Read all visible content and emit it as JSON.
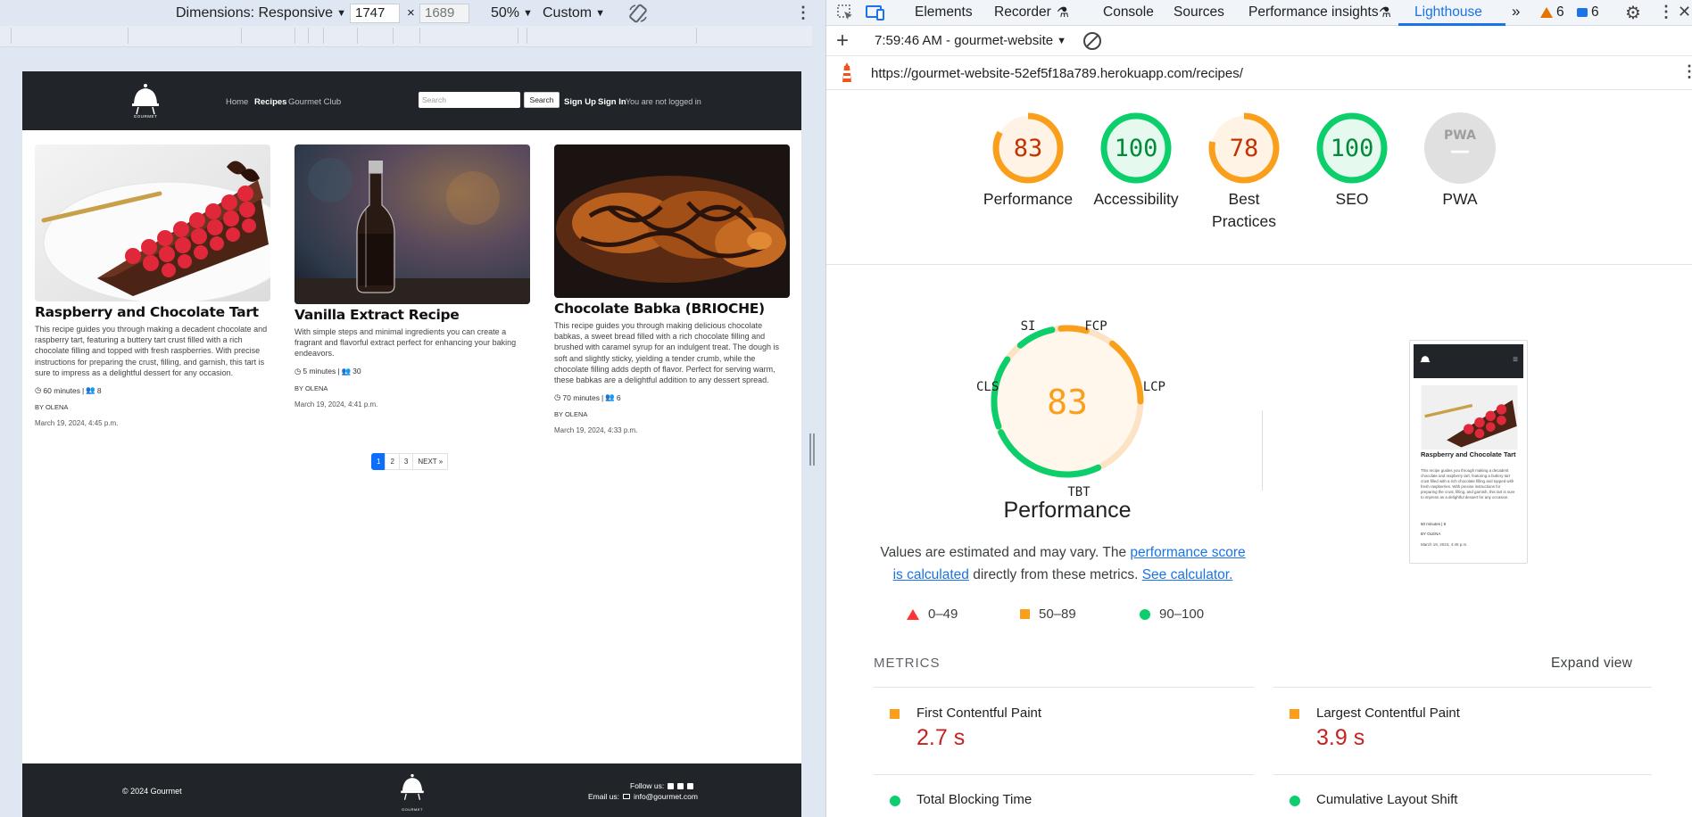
{
  "device_toolbar": {
    "dimensions_label": "Dimensions: Responsive",
    "width": "1747",
    "height_placeholder": "1689",
    "times": "×",
    "zoom": "50%",
    "throttle": "Custom"
  },
  "website": {
    "nav": {
      "logo_text": "GOURMET",
      "links": [
        "Home",
        "Recipes",
        "Gourmet Club"
      ],
      "search_placeholder": "Search",
      "search_button": "Search",
      "sign_up": "Sign Up",
      "sign_in": "Sign In",
      "login_status": "You are not logged in"
    },
    "recipes": [
      {
        "title": "Raspberry and Chocolate Tart",
        "description": "This recipe guides you through making a decadent chocolate and raspberry tart, featuring a buttery tart crust filled with a rich chocolate filling and topped with fresh raspberries. With precise instructions for preparing the crust, filling, and garnish, this tart is sure to impress as a delightful dessert for any occasion.",
        "time": "60 minutes",
        "servings": "8",
        "author": "BY OLENA",
        "date": "March 19, 2024, 4:45 p.m."
      },
      {
        "title": "Vanilla Extract Recipe",
        "description": "With simple steps and minimal ingredients you can create a fragrant and flavorful extract perfect for enhancing your baking endeavors.",
        "time": "5 minutes",
        "servings": "30",
        "author": "BY OLENA",
        "date": "March 19, 2024, 4:41 p.m."
      },
      {
        "title": "Chocolate Babka (BRIOCHE)",
        "description": "This recipe guides you through making delicious chocolate babkas, a sweet bread filled with a rich chocolate filling and brushed with caramel syrup for an indulgent treat. The dough is soft and slightly sticky, yielding a tender crumb, while the chocolate filling adds depth of flavor. Perfect for serving warm, these babkas are a delightful addition to any dessert spread.",
        "time": "70 minutes",
        "servings": "6",
        "author": "BY OLENA",
        "date": "March 19, 2024, 4:33 p.m."
      }
    ],
    "pagination": [
      "1",
      "2",
      "3",
      "NEXT »"
    ],
    "footer": {
      "copyright": "© 2024 Gourmet",
      "follow": "Follow us:",
      "email_label": "Email us:",
      "email": "info@gourmet.com",
      "logo_text": "GOURMET"
    }
  },
  "devtools": {
    "tabs": [
      "Elements",
      "Recorder",
      "Console",
      "Sources",
      "Performance insights",
      "Lighthouse"
    ],
    "warnings": "6",
    "messages": "6",
    "report_time": "7:59:46 AM - gourmet-website",
    "url": "https://gourmet-website-52ef5f18a789.herokuapp.com/recipes/",
    "scores": [
      {
        "label": "Performance",
        "value": 83,
        "color": "#fa9f1c"
      },
      {
        "label": "Accessibility",
        "value": 100,
        "color": "#0cce6b"
      },
      {
        "label": "Best Practices",
        "value": 78,
        "color": "#fa9f1c"
      },
      {
        "label": "SEO",
        "value": 100,
        "color": "#0cce6b"
      },
      {
        "label": "PWA",
        "value": null,
        "color": "#bdbdbd"
      }
    ],
    "pwa_badge": "PWA",
    "pwa_dash": "—",
    "big_gauge": {
      "score": "83",
      "title": "Performance",
      "labels": {
        "si": "SI",
        "fcp": "FCP",
        "lcp": "LCP",
        "tbt": "TBT",
        "cls": "CLS"
      }
    },
    "note": {
      "pre": "Values are estimated and may vary. The ",
      "link1": "performance score is calculated",
      "mid": " directly from these metrics. ",
      "link2": "See calculator."
    },
    "legend": [
      "0–49",
      "50–89",
      "90–100"
    ],
    "metrics_heading": "METRICS",
    "expand_view": "Expand view",
    "metrics": [
      {
        "name": "First Contentful Paint",
        "value": "2.7 s",
        "status": "average"
      },
      {
        "name": "Largest Contentful Paint",
        "value": "3.9 s",
        "status": "average"
      },
      {
        "name": "Total Blocking Time",
        "value": "",
        "status": "pass"
      },
      {
        "name": "Cumulative Layout Shift",
        "value": "",
        "status": "pass"
      }
    ],
    "thumbnail": {
      "title": "Raspberry and Chocolate Tart",
      "text": "This recipe guides you through making a decadent chocolate and raspberry tart, featuring a buttery tart crust filled with a rich chocolate filling and topped with fresh raspberries. With precise instructions for preparing the crust, filling, and garnish, this tart is sure to impress as a delightful dessert for any occasion.",
      "meta": "60 minutes | 8",
      "author": "BY OLENA",
      "date": "March 19, 2024, 4:45 p.m."
    }
  }
}
